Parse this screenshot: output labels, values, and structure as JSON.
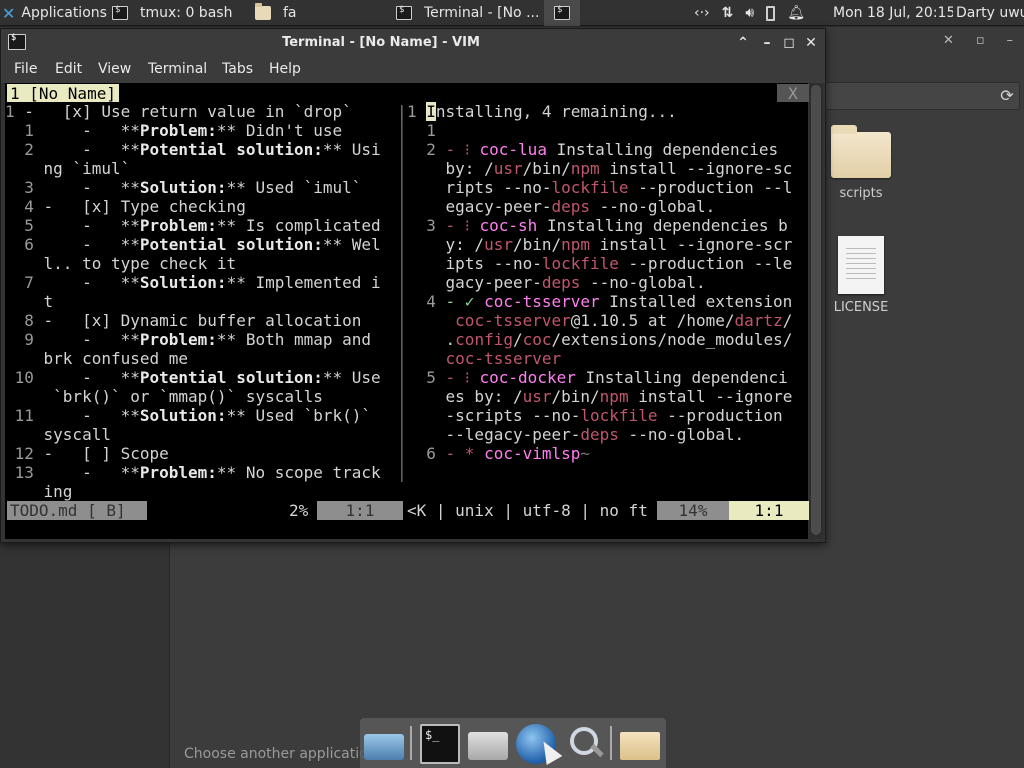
{
  "top_panel": {
    "applications": "Applications",
    "tasks": [
      {
        "label": "tmux: 0 bash"
      },
      {
        "label": "fa"
      },
      {
        "label": "Terminal - [No ..."
      }
    ],
    "datetime": "Mon 18 Jul, 20:15",
    "user": "Darty uwu"
  },
  "file_manager": {
    "items": [
      {
        "label": "scripts",
        "type": "folder"
      },
      {
        "label": "LICENSE",
        "type": "file"
      }
    ],
    "status": "Choose another application"
  },
  "terminal": {
    "title": "Terminal - [No Name] - VIM",
    "menu": [
      "File",
      "Edit",
      "View",
      "Terminal",
      "Tabs",
      "Help"
    ],
    "vim": {
      "tab_label": "1 [No Name]",
      "tab_close": "X",
      "left_lines": [
        [
          "1 ",
          "-   [x] Use return value in `drop`"
        ],
        [
          "  1 ",
          "    -   **",
          "Problem:",
          "** Didn't use"
        ],
        [
          "  2 ",
          "    -   **",
          "Potential solution:",
          "** Usi"
        ],
        [
          "    ",
          "ng `imul`"
        ],
        [
          "  3 ",
          "    -   **",
          "Solution:",
          "** Used `imul`"
        ],
        [
          "  4 ",
          "-   [x] Type checking"
        ],
        [
          "  5 ",
          "    -   **",
          "Problem:",
          "** Is complicated"
        ],
        [
          "  6 ",
          "    -   **",
          "Potential solution:",
          "** Wel"
        ],
        [
          "    ",
          "l.. to type check it"
        ],
        [
          "  7 ",
          "    -   **",
          "Solution:",
          "** Implemented i"
        ],
        [
          "    ",
          "t"
        ],
        [
          "  8 ",
          "-   [x] Dynamic buffer allocation"
        ],
        [
          "  9 ",
          "    -   **",
          "Problem:",
          "** Both mmap and"
        ],
        [
          "    ",
          "brk confused me"
        ],
        [
          " 10 ",
          "    -   **",
          "Potential solution:",
          "** Use"
        ],
        [
          "    ",
          " `brk()` or `mmap()` syscalls"
        ],
        [
          " 11 ",
          "    -   **",
          "Solution:",
          "** Used `brk()`"
        ],
        [
          "    ",
          "syscall"
        ],
        [
          " 12 ",
          "-   [ ] Scope"
        ],
        [
          " 13 ",
          "    -   **",
          "Problem:",
          "** No scope track"
        ],
        [
          "    ",
          "ing"
        ]
      ],
      "right": {
        "line1_num": "1 ",
        "cursor_char": "I",
        "line1_rest": "nstalling, 4 remaining...",
        "line2_num": "  1",
        "items": [
          {
            "num": "  2 ",
            "mark": "- ⁝ ",
            "name": "coc-lua",
            "lines": [
              " Installing dependencies",
              "by: /{usr}/bin/{npm} install --ignore-sc",
              "ripts --no-{lockfile} --production --l",
              "egacy-peer-{deps} --no-global."
            ]
          },
          {
            "num": "  3 ",
            "mark": "- ⁝ ",
            "name": "coc-sh",
            "lines": [
              " Installing dependencies b",
              "y: /{usr}/bin/{npm} install --ignore-scr",
              "ipts --no-{lockfile} --production --le",
              "gacy-peer-{deps} --no-global."
            ]
          },
          {
            "num": "  4 ",
            "mark": "- ✓ ",
            "name": "coc-tsserver",
            "lines": [
              " Installed extension",
              " {coc-tsserver}@1.10.5 at /home/{dartz}/",
              ".{config}/{coc}/extensions/node_modules/",
              "{coc-tsserver}"
            ]
          },
          {
            "num": "  5 ",
            "mark": "- ⁝ ",
            "name": "coc-docker",
            "lines": [
              " Installing dependenci",
              "es by: /{usr}/bin/{npm} install --ignore",
              "-scripts --no-{lockfile} --production",
              "--legacy-peer-{deps} --no-global."
            ]
          },
          {
            "num": "  6 ",
            "mark": "- * ",
            "name": "coc-vimlsp",
            "lines": [
              "~"
            ]
          }
        ]
      },
      "status_left": "TODO.md [ B]",
      "status_pct": "2%",
      "status_pos": "1:1",
      "status_mid": "<K | unix | utf-8 | no ft",
      "status_pct2": "14%",
      "status_pos2": "1:1"
    }
  }
}
